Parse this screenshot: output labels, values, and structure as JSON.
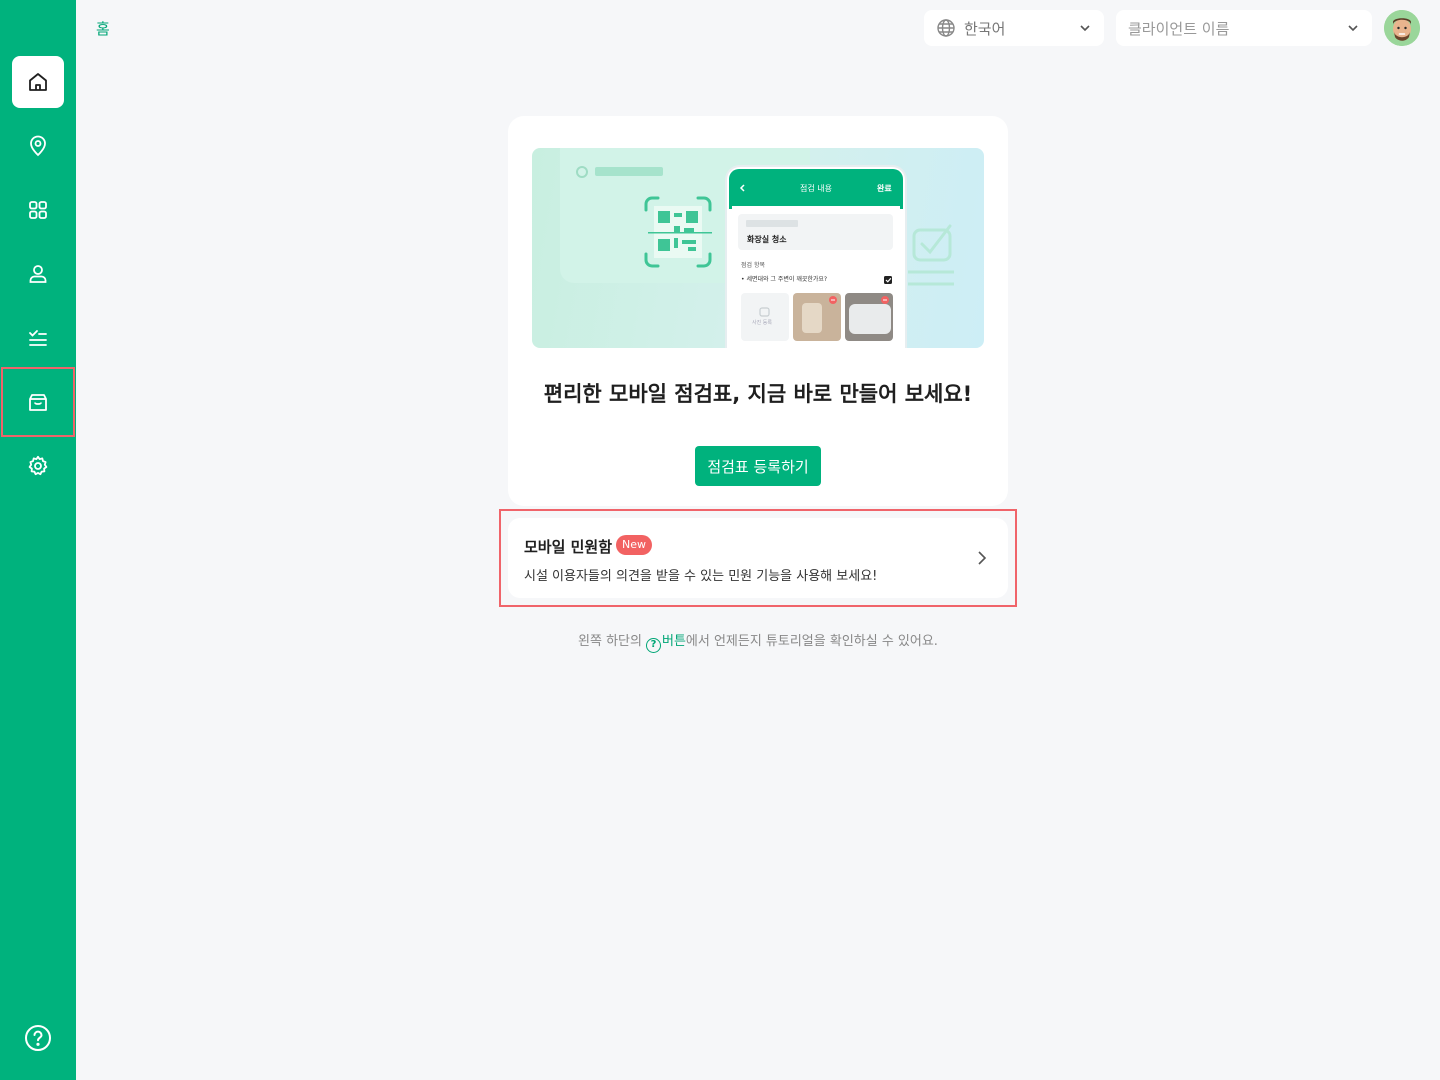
{
  "colors": {
    "brand": "#00b27d",
    "highlight": "#f0646a",
    "badge": "#f26262"
  },
  "sidebar": {
    "items": [
      {
        "name": "home",
        "icon": "home-icon",
        "active": true
      },
      {
        "name": "location",
        "icon": "map-pin-icon"
      },
      {
        "name": "apps",
        "icon": "grid-icon"
      },
      {
        "name": "user",
        "icon": "user-icon"
      },
      {
        "name": "checklist",
        "icon": "checklist-icon"
      },
      {
        "name": "inbox",
        "icon": "inbox-icon"
      },
      {
        "name": "settings",
        "icon": "gear-icon"
      }
    ],
    "help_icon": "help-circle-icon"
  },
  "header": {
    "breadcrumb": "홈",
    "language_value": "한국어",
    "client_placeholder": "클라이언트 이름"
  },
  "illustration": {
    "phone_title": "점검 내용",
    "phone_done": "완료",
    "task_title": "화장실 청소",
    "section_label": "점검 항목",
    "check_item": "• 세면대와 그 주변이 깨끗한가요?",
    "photo_label": "사진 등록"
  },
  "card": {
    "title": "편리한 모바일 점검표, 지금 바로 만들어 보세요!",
    "button_label": "점검표 등록하기"
  },
  "complaint": {
    "title": "모바일 민원함",
    "badge": "New",
    "description": "시설 이용자들의 의견을 받을 수 있는 민원 기능을 사용해 보세요!"
  },
  "tip": {
    "prefix": "왼쪽 하단의",
    "icon_text": "?",
    "accent": "버튼",
    "suffix": "에서 언제든지 튜토리얼을 확인하실 수 있어요."
  }
}
